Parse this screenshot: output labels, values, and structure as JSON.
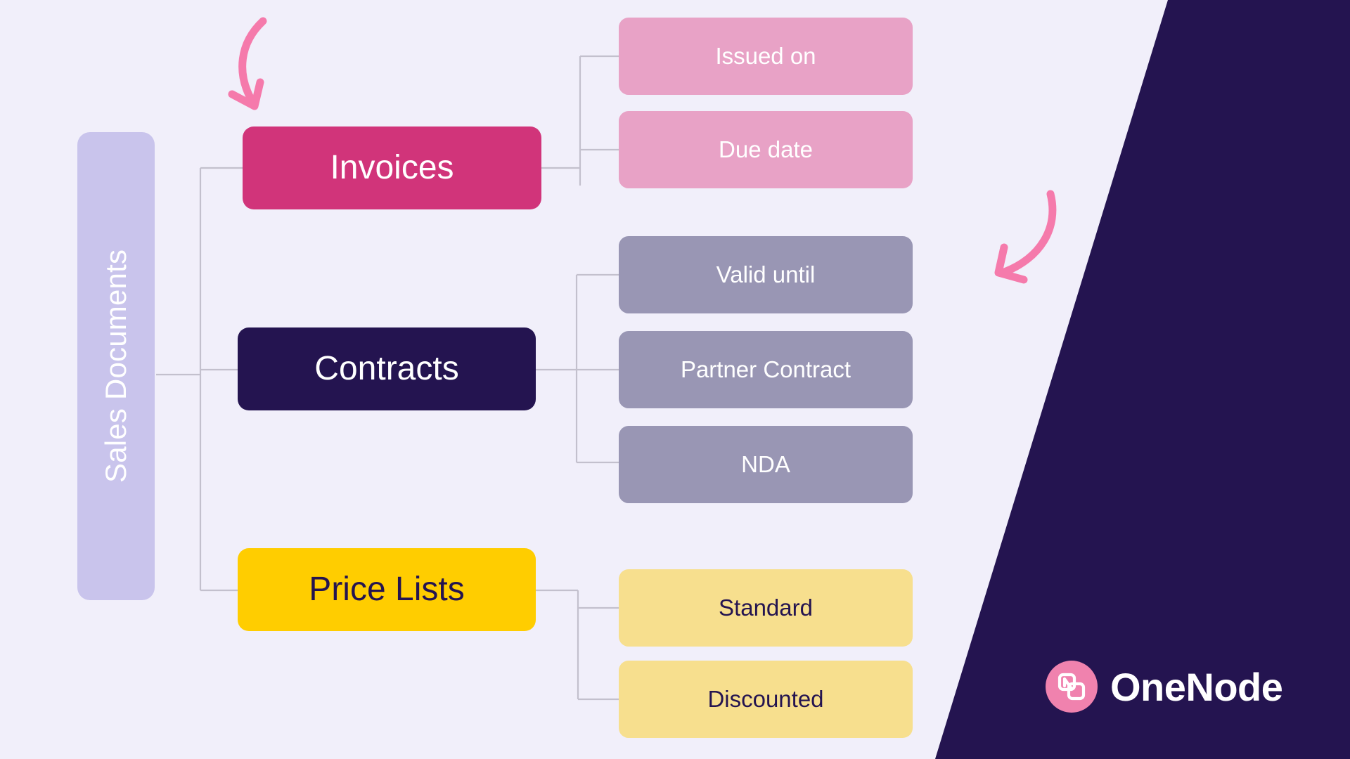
{
  "canvas": {
    "background_color": "#f1effa",
    "panel_color": "#241450"
  },
  "diagram": {
    "type": "tree",
    "root": {
      "label": "Sales Documents",
      "color": "#c9c4ec",
      "text_color": "#ffffff",
      "orientation": "vertical"
    },
    "branches": [
      {
        "label": "Invoices",
        "color": "#d1347a",
        "text_color": "#ffffff",
        "children": [
          {
            "label": "Issued on",
            "color": "#e8a2c6",
            "text_color": "#ffffff"
          },
          {
            "label": "Due date",
            "color": "#e8a2c6",
            "text_color": "#ffffff"
          }
        ]
      },
      {
        "label": "Contracts",
        "color": "#241450",
        "text_color": "#ffffff",
        "children": [
          {
            "label": "Valid until",
            "color": "#9996b4",
            "text_color": "#ffffff"
          },
          {
            "label": "Partner Contract",
            "color": "#9996b4",
            "text_color": "#ffffff"
          },
          {
            "label": "NDA",
            "color": "#9996b4",
            "text_color": "#ffffff"
          }
        ]
      },
      {
        "label": "Price Lists",
        "color": "#ffcd00",
        "text_color": "#241450",
        "children": [
          {
            "label": "Standard",
            "color": "#f7df8e",
            "text_color": "#241450"
          },
          {
            "label": "Discounted",
            "color": "#f7df8e",
            "text_color": "#241450"
          }
        ]
      }
    ],
    "connector_color": "#c3c0cd"
  },
  "annotations": {
    "arrow_color": "#f57aab",
    "arrows": [
      {
        "name": "arrow-pointing-to-invoices",
        "direction": "down"
      },
      {
        "name": "arrow-pointing-down-left",
        "direction": "down-left"
      }
    ]
  },
  "brand": {
    "name": "OneNode",
    "mark_color": "#f082ae",
    "text_color": "#ffffff",
    "icon": "onenode-n-logo-icon"
  }
}
